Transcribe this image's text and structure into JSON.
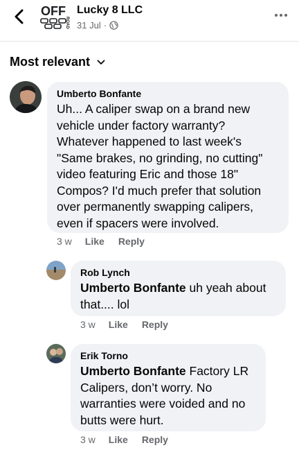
{
  "header": {
    "page_name": "Lucky 8 LLC",
    "post_date": "31 Jul",
    "separator": "·",
    "logo_text_top": "OFF",
    "logo_text_side": "ROAD"
  },
  "sort": {
    "label": "Most relevant"
  },
  "comments": [
    {
      "author": "Umberto Bonfante",
      "mention": "",
      "text": "Uh... A caliper swap on a brand new vehicle under factory warranty? Whatever happened to last week's \"Same brakes, no grinding, no cutting\" video featuring Eric and those 18\" Compos? I'd much prefer that solution over permanently swapping calipers, even if spacers were involved.",
      "age": "3 w",
      "like_label": "Like",
      "reply_label": "Reply"
    },
    {
      "author": "Rob Lynch",
      "mention": "Umberto Bonfante",
      "text": " uh yeah about that.... lol",
      "age": "3 w",
      "like_label": "Like",
      "reply_label": "Reply"
    },
    {
      "author": "Erik Torno",
      "mention": "Umberto Bonfante",
      "text": " Factory LR Calipers, don’t worry. No warranties were voided and no butts were hurt.",
      "age": "3 w",
      "like_label": "Like",
      "reply_label": "Reply"
    }
  ],
  "colors": {
    "bubble": "#f0f2f5",
    "secondary_text": "#65676b",
    "primary_text": "#050505",
    "divider": "#e4e6eb"
  },
  "icons": {
    "back": "chevron-left-icon",
    "privacy": "globe-icon",
    "more": "more-dots-icon",
    "sort": "chevron-down-icon"
  }
}
